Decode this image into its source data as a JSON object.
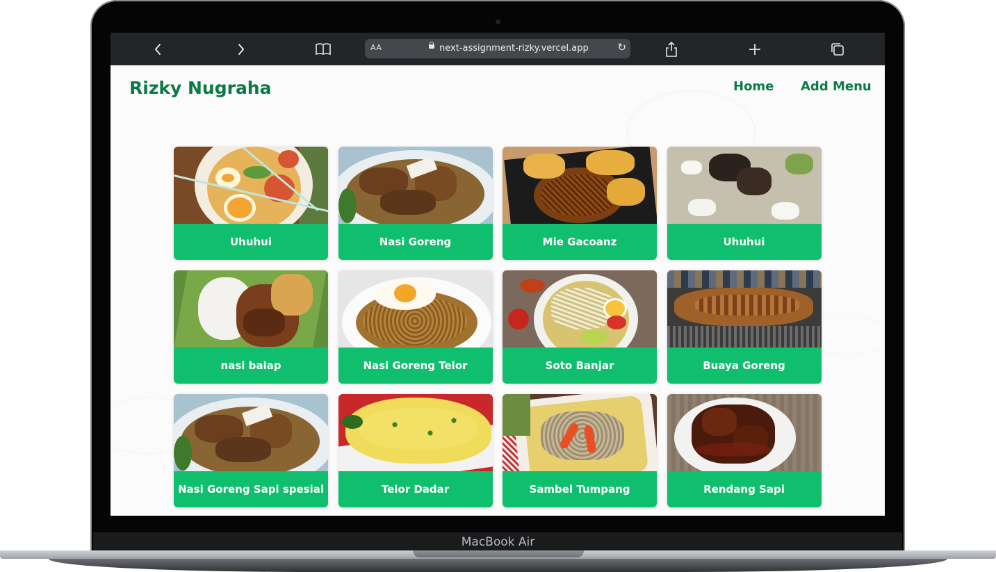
{
  "browser": {
    "back_icon": "chevron-left-icon",
    "forward_icon": "chevron-right-icon",
    "bookmarks_icon": "book-icon",
    "aa_label": "AA",
    "url": "next-assignment-rizky.vercel.app",
    "share_icon": "share-icon",
    "new_tab_icon": "plus-icon",
    "tabs_icon": "tabs-icon"
  },
  "device": {
    "model_label": "MacBook Air"
  },
  "header": {
    "brand": "Rizky Nugraha",
    "nav": {
      "home": "Home",
      "add_menu": "Add Menu"
    }
  },
  "menu_items": [
    {
      "name": "Uhuhui",
      "theme": "ramen"
    },
    {
      "name": "Nasi Goreng",
      "theme": "fried-rice"
    },
    {
      "name": "Mie Gacoanz",
      "theme": "noodles"
    },
    {
      "name": "Uhuhui",
      "theme": "soup"
    },
    {
      "name": "nasi balap",
      "theme": "rice-plate"
    },
    {
      "name": "Nasi Goreng Telor",
      "theme": "fried-rice-egg"
    },
    {
      "name": "Soto Banjar",
      "theme": "soto"
    },
    {
      "name": "Buaya Goreng",
      "theme": "grilled"
    },
    {
      "name": "Nasi Goreng Sapi spesial",
      "theme": "fried-rice"
    },
    {
      "name": "Telor Dadar",
      "theme": "omelette"
    },
    {
      "name": "Sambel Tumpang",
      "theme": "sambal"
    },
    {
      "name": "Rendang Sapi",
      "theme": "rendang"
    }
  ],
  "colors": {
    "brand_green": "#0b7a46",
    "card_green": "#0fbf6d",
    "toolbar": "#232528"
  }
}
